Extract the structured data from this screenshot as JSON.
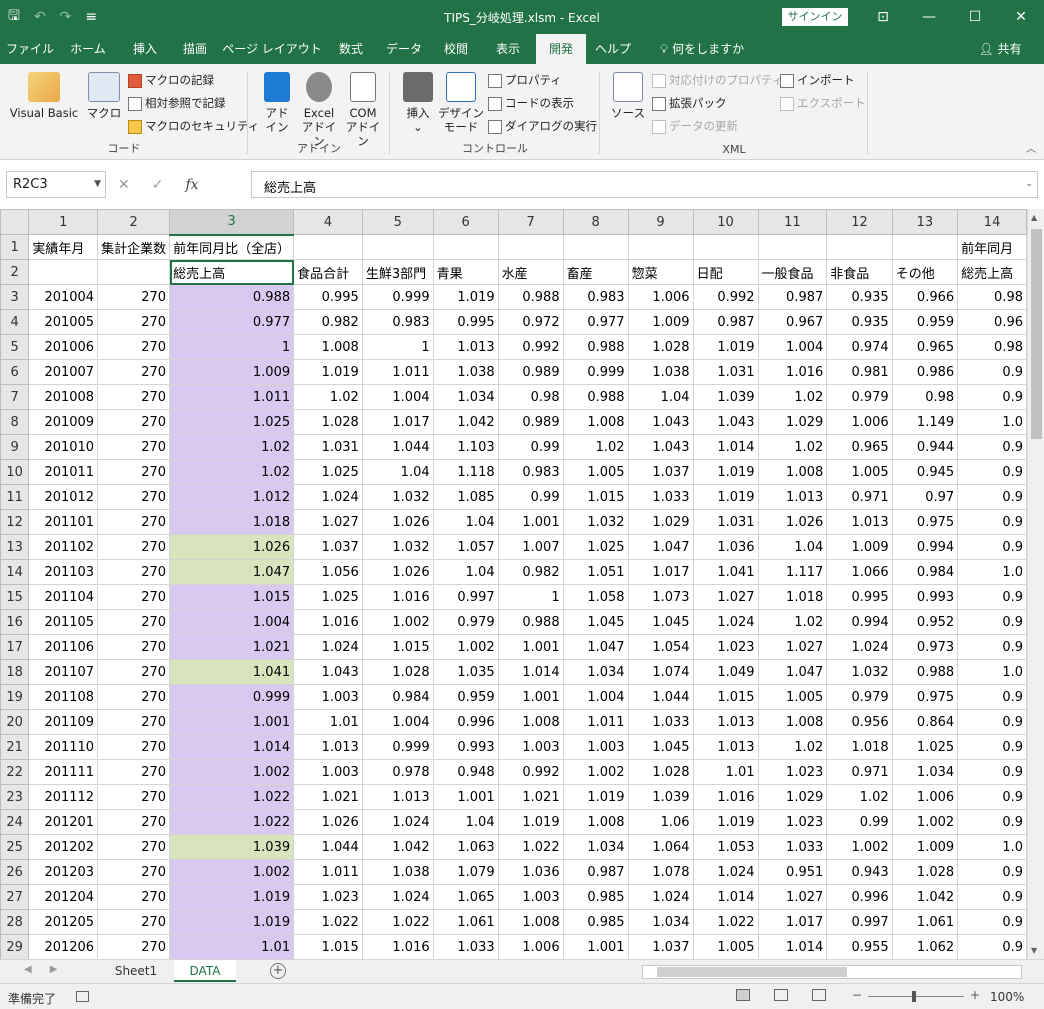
{
  "window": {
    "title": "TIPS_分岐処理.xlsm  -  Excel",
    "signin": "サインイン",
    "qat": {
      "save": "🖫",
      "undo": "↶",
      "redo": "↷",
      "custom": "≡"
    },
    "controls": {
      "ribbon_display": "⊡",
      "minimize": "—",
      "maximize": "☐",
      "close": "✕"
    }
  },
  "tabs": [
    "ファイル",
    "ホーム",
    "挿入",
    "描画",
    "ページ レイアウト",
    "数式",
    "データ",
    "校閲",
    "表示",
    "開発",
    "ヘルプ",
    "何をしますか"
  ],
  "active_tab": "開発",
  "share": "共有",
  "ribbon": {
    "code": {
      "label": "コード",
      "visual_basic": "Visual Basic",
      "macro": "マクロ",
      "record_macro": "マクロの記録",
      "relative_ref": "相対参照で記録",
      "macro_security": "マクロのセキュリティ"
    },
    "addins": {
      "label": "アドイン",
      "addin": [
        "アド",
        "イン"
      ],
      "excel_addin": [
        "Excel",
        "アドイン"
      ],
      "com_addin": [
        "COM",
        "アドイン"
      ]
    },
    "controls": {
      "label": "コントロール",
      "insert": "挿入",
      "design_mode": [
        "デザイン",
        "モード"
      ],
      "properties": "プロパティ",
      "view_code": "コードの表示",
      "run_dialog": "ダイアログの実行"
    },
    "xml": {
      "label": "XML",
      "source": "ソース",
      "map_properties": "対応付けのプロパティ",
      "expansion_packs": "拡張パック",
      "refresh_data": "データの更新",
      "import": "インポート",
      "export": "エクスポート"
    }
  },
  "formula_bar": {
    "name_box": "R2C3",
    "cancel": "✕",
    "enter": "✓",
    "fx": "fx",
    "value": "総売上高"
  },
  "sheet": {
    "column_headers": [
      "1",
      "2",
      "3",
      "4",
      "5",
      "6",
      "7",
      "8",
      "9",
      "10",
      "11",
      "12",
      "13",
      "14"
    ],
    "row1": [
      "実績年月",
      "集計企業数",
      "前年同月比（全店）",
      "",
      "",
      "",
      "",
      "",
      "",
      "",
      "",
      "",
      "",
      "前年同月"
    ],
    "row2": [
      "",
      "",
      "総売上高",
      "食品合計",
      "生鮮3部門",
      "青果",
      "水産",
      "畜産",
      "惣菜",
      "日配",
      "一般食品",
      "非食品",
      "その他",
      "総売上高"
    ],
    "rows": [
      [
        "201004",
        "270",
        "0.988",
        "0.995",
        "0.999",
        "1.019",
        "0.988",
        "0.983",
        "1.006",
        "0.992",
        "0.987",
        "0.935",
        "0.966",
        "0.98"
      ],
      [
        "201005",
        "270",
        "0.977",
        "0.982",
        "0.983",
        "0.995",
        "0.972",
        "0.977",
        "1.009",
        "0.987",
        "0.967",
        "0.935",
        "0.959",
        "0.96"
      ],
      [
        "201006",
        "270",
        "1",
        "1.008",
        "1",
        "1.013",
        "0.992",
        "0.988",
        "1.028",
        "1.019",
        "1.004",
        "0.974",
        "0.965",
        "0.98"
      ],
      [
        "201007",
        "270",
        "1.009",
        "1.019",
        "1.011",
        "1.038",
        "0.989",
        "0.999",
        "1.038",
        "1.031",
        "1.016",
        "0.981",
        "0.986",
        "0.9"
      ],
      [
        "201008",
        "270",
        "1.011",
        "1.02",
        "1.004",
        "1.034",
        "0.98",
        "0.988",
        "1.04",
        "1.039",
        "1.02",
        "0.979",
        "0.98",
        "0.9"
      ],
      [
        "201009",
        "270",
        "1.025",
        "1.028",
        "1.017",
        "1.042",
        "0.989",
        "1.008",
        "1.043",
        "1.043",
        "1.029",
        "1.006",
        "1.149",
        "1.0"
      ],
      [
        "201010",
        "270",
        "1.02",
        "1.031",
        "1.044",
        "1.103",
        "0.99",
        "1.02",
        "1.043",
        "1.014",
        "1.02",
        "0.965",
        "0.944",
        "0.9"
      ],
      [
        "201011",
        "270",
        "1.02",
        "1.025",
        "1.04",
        "1.118",
        "0.983",
        "1.005",
        "1.037",
        "1.019",
        "1.008",
        "1.005",
        "0.945",
        "0.9"
      ],
      [
        "201012",
        "270",
        "1.012",
        "1.024",
        "1.032",
        "1.085",
        "0.99",
        "1.015",
        "1.033",
        "1.019",
        "1.013",
        "0.971",
        "0.97",
        "0.9"
      ],
      [
        "201101",
        "270",
        "1.018",
        "1.027",
        "1.026",
        "1.04",
        "1.001",
        "1.032",
        "1.029",
        "1.031",
        "1.026",
        "1.013",
        "0.975",
        "0.9"
      ],
      [
        "201102",
        "270",
        "1.026",
        "1.037",
        "1.032",
        "1.057",
        "1.007",
        "1.025",
        "1.047",
        "1.036",
        "1.04",
        "1.009",
        "0.994",
        "0.9"
      ],
      [
        "201103",
        "270",
        "1.047",
        "1.056",
        "1.026",
        "1.04",
        "0.982",
        "1.051",
        "1.017",
        "1.041",
        "1.117",
        "1.066",
        "0.984",
        "1.0"
      ],
      [
        "201104",
        "270",
        "1.015",
        "1.025",
        "1.016",
        "0.997",
        "1",
        "1.058",
        "1.073",
        "1.027",
        "1.018",
        "0.995",
        "0.993",
        "0.9"
      ],
      [
        "201105",
        "270",
        "1.004",
        "1.016",
        "1.002",
        "0.979",
        "0.988",
        "1.045",
        "1.045",
        "1.024",
        "1.02",
        "0.994",
        "0.952",
        "0.9"
      ],
      [
        "201106",
        "270",
        "1.021",
        "1.024",
        "1.015",
        "1.002",
        "1.001",
        "1.047",
        "1.054",
        "1.023",
        "1.027",
        "1.024",
        "0.973",
        "0.9"
      ],
      [
        "201107",
        "270",
        "1.041",
        "1.043",
        "1.028",
        "1.035",
        "1.014",
        "1.034",
        "1.074",
        "1.049",
        "1.047",
        "1.032",
        "0.988",
        "1.0"
      ],
      [
        "201108",
        "270",
        "0.999",
        "1.003",
        "0.984",
        "0.959",
        "1.001",
        "1.004",
        "1.044",
        "1.015",
        "1.005",
        "0.979",
        "0.975",
        "0.9"
      ],
      [
        "201109",
        "270",
        "1.001",
        "1.01",
        "1.004",
        "0.996",
        "1.008",
        "1.011",
        "1.033",
        "1.013",
        "1.008",
        "0.956",
        "0.864",
        "0.9"
      ],
      [
        "201110",
        "270",
        "1.014",
        "1.013",
        "0.999",
        "0.993",
        "1.003",
        "1.003",
        "1.045",
        "1.013",
        "1.02",
        "1.018",
        "1.025",
        "0.9"
      ],
      [
        "201111",
        "270",
        "1.002",
        "1.003",
        "0.978",
        "0.948",
        "0.992",
        "1.002",
        "1.028",
        "1.01",
        "1.023",
        "0.971",
        "1.034",
        "0.9"
      ],
      [
        "201112",
        "270",
        "1.022",
        "1.021",
        "1.013",
        "1.001",
        "1.021",
        "1.019",
        "1.039",
        "1.016",
        "1.029",
        "1.02",
        "1.006",
        "0.9"
      ],
      [
        "201201",
        "270",
        "1.022",
        "1.026",
        "1.024",
        "1.04",
        "1.019",
        "1.008",
        "1.06",
        "1.019",
        "1.023",
        "0.99",
        "1.002",
        "0.9"
      ],
      [
        "201202",
        "270",
        "1.039",
        "1.044",
        "1.042",
        "1.063",
        "1.022",
        "1.034",
        "1.064",
        "1.053",
        "1.033",
        "1.002",
        "1.009",
        "1.0"
      ],
      [
        "201203",
        "270",
        "1.002",
        "1.011",
        "1.038",
        "1.079",
        "1.036",
        "0.987",
        "1.078",
        "1.024",
        "0.951",
        "0.943",
        "1.028",
        "0.9"
      ],
      [
        "201204",
        "270",
        "1.019",
        "1.023",
        "1.024",
        "1.065",
        "1.003",
        "0.985",
        "1.024",
        "1.014",
        "1.027",
        "0.996",
        "1.042",
        "0.9"
      ],
      [
        "201205",
        "270",
        "1.019",
        "1.022",
        "1.022",
        "1.061",
        "1.008",
        "0.985",
        "1.034",
        "1.022",
        "1.017",
        "0.997",
        "1.061",
        "0.9"
      ],
      [
        "201206",
        "270",
        "1.01",
        "1.015",
        "1.016",
        "1.033",
        "1.006",
        "1.001",
        "1.037",
        "1.005",
        "1.014",
        "0.955",
        "1.062",
        "0.9"
      ]
    ],
    "highlight_green_rows": [
      13,
      14,
      18,
      25
    ],
    "highlight_purple_column": 3,
    "active_cell": {
      "row": 2,
      "col": 3
    }
  },
  "sheet_tabs": [
    "Sheet1",
    "DATA"
  ],
  "active_sheet": "DATA",
  "status": {
    "ready": "準備完了",
    "zoom": "100%",
    "zoom_minus": "−",
    "zoom_plus": "+"
  },
  "colors": {
    "brand": "#217346",
    "purple": "#d9c8f0",
    "green": "#d8e4bc"
  }
}
